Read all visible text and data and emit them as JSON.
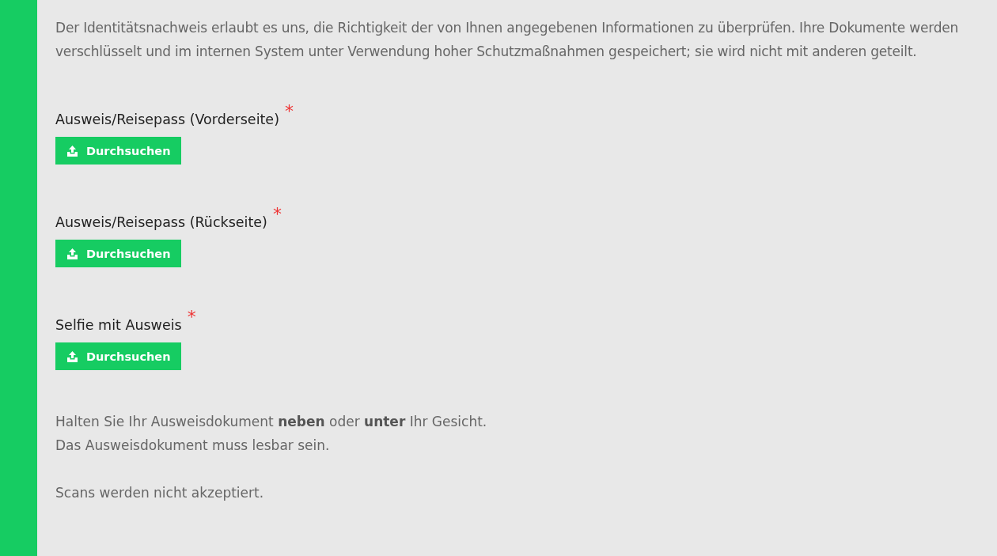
{
  "intro": "Der Identitätsnachweis erlaubt es uns, die Richtigkeit der von Ihnen angegebenen Informationen zu überprüfen. Ihre Dokumente werden verschlüsselt und im internen System unter Verwendung hoher Schutzmaßnahmen gespeichert; sie wird nicht mit anderen geteilt.",
  "uploads": [
    {
      "label": "Ausweis/Reisepass (Vorderseite)",
      "required": true,
      "required_mark": "*",
      "button": "Durchsuchen"
    },
    {
      "label": "Ausweis/Reisepass (Rückseite)",
      "required": true,
      "required_mark": "*",
      "button": "Durchsuchen"
    },
    {
      "label": "Selfie mit Ausweis",
      "required": true,
      "required_mark": "*",
      "button": "Durchsuchen"
    }
  ],
  "notes": [
    "Halten Sie Ihr Ausweisdokument **neben** oder **unter** Ihr Gesicht.",
    "Das Ausweisdokument muss lesbar sein."
  ],
  "footer_note": "Scans werden nicht akzeptiert."
}
